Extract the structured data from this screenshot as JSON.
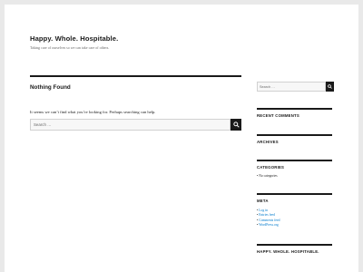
{
  "site": {
    "title": "Happy. Whole. Hospitable.",
    "tagline": "Taking care of ourselves so we can take care of others."
  },
  "main": {
    "page_title": "Nothing Found",
    "message": "It seems we can’t find what you’re looking for. Perhaps searching can help.",
    "search_placeholder": "Search …"
  },
  "sidebar": {
    "search_placeholder": "Search …",
    "widgets": {
      "recent_comments": {
        "title": "RECENT COMMENTS"
      },
      "archives": {
        "title": "ARCHIVES"
      },
      "categories": {
        "title": "CATEGORIES",
        "items": [
          "No categories"
        ]
      },
      "meta": {
        "title": "META",
        "items": [
          "Log in",
          "Entries feed",
          "Comments feed",
          "WordPress.org"
        ]
      },
      "text": {
        "title": "HAPPY. WHOLE. HOSPITABLE."
      }
    }
  },
  "icons": {
    "search": "search-icon"
  },
  "colors": {
    "accent_link": "#007acc",
    "text": "#1a1a1a",
    "rule": "#1a1a1a",
    "page_bg": "#e9e9e9"
  }
}
